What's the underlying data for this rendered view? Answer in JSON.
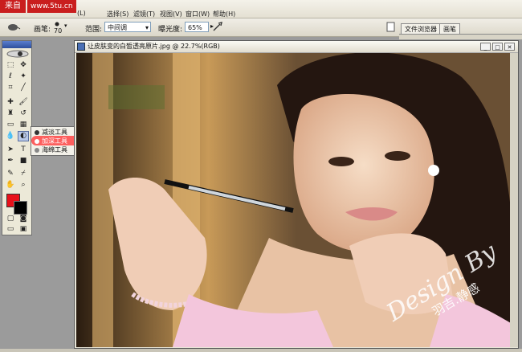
{
  "menubar": {
    "badge": "来自",
    "url": "www.5tu.cn",
    "items": [
      "(L)",
      "选择(S)",
      "滤镜(T)",
      "视图(V)",
      "窗口(W)",
      "帮助(H)"
    ]
  },
  "options": {
    "brush_label": "画笔:",
    "brush_size": "70",
    "range_label": "范围:",
    "range_value": "中间调",
    "exposure_label": "曝光度:",
    "exposure_value": "65%"
  },
  "palette_well": {
    "tabs": [
      "文件浏览器",
      "画笔"
    ]
  },
  "flyout": {
    "items": [
      {
        "label": "减淡工具",
        "key": "O"
      },
      {
        "label": "加深工具",
        "key": "O"
      },
      {
        "label": "海绵工具",
        "key": "O"
      }
    ]
  },
  "document": {
    "title": "让皮肤变的白皙透亮原片.jpg @ 22.7%(RGB)",
    "signature": "Design By",
    "signature_name": "羽吉.静感"
  },
  "colors": {
    "foreground": "#e8101a",
    "background": "#000000",
    "highlight": "#ff3b3b"
  }
}
